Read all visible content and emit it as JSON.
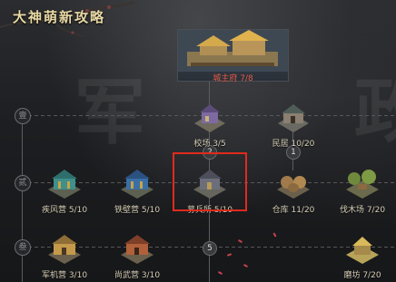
{
  "page_title": "大神萌新攻略",
  "watermarks": [
    "军",
    "政"
  ],
  "tiers": [
    {
      "label": "壹",
      "numbers": [
        "2",
        "1"
      ]
    },
    {
      "label": "贰",
      "numbers": []
    },
    {
      "label": "叁",
      "numbers": [
        "5"
      ]
    }
  ],
  "headquarters": {
    "name": "城主府",
    "level": "7/8"
  },
  "row1": [
    {
      "name": "校场",
      "level": "3/5"
    },
    {
      "name": "民居",
      "level": "10/20"
    }
  ],
  "row2": [
    {
      "name": "疾风营",
      "level": "5/10"
    },
    {
      "name": "铁壁营",
      "level": "5/10"
    },
    {
      "name": "募兵所",
      "level": "5/10",
      "highlighted": true
    },
    {
      "name": "仓库",
      "level": "11/20"
    },
    {
      "name": "伐木场",
      "level": "7/20"
    }
  ],
  "row3": [
    {
      "name": "军机营",
      "level": "3/10"
    },
    {
      "name": "尚武营",
      "level": "3/10"
    },
    {
      "name": "磨坊",
      "level": "7/20"
    }
  ],
  "colors": {
    "highlight": "#e02a1e",
    "hq_label": "#e35b45",
    "title": "#e9d9a4"
  }
}
